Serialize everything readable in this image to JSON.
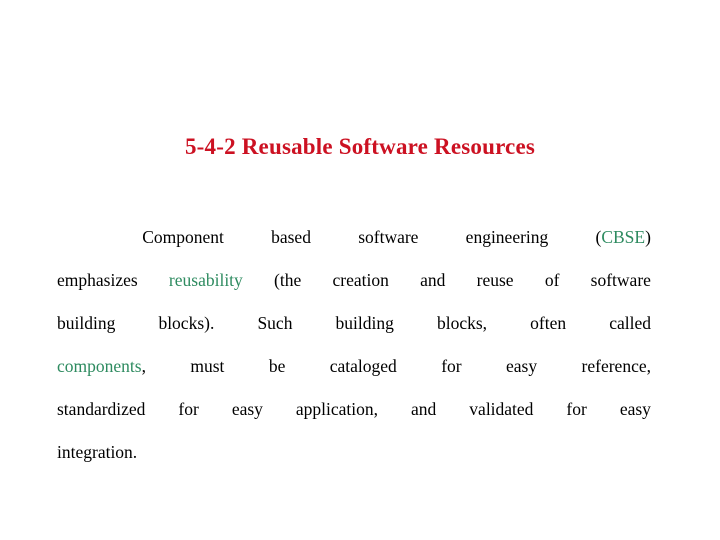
{
  "slide": {
    "background_color": "#ffffff",
    "title": "5-4-2 Reusable Software Resources",
    "title_color": "#cc1122",
    "body_color": "#000000",
    "highlight_color": "#2e8b60"
  },
  "body": {
    "full_text": "Component based software engineering (CBSE) emphasizes reusability (the creation and reuse of software building blocks). Such building blocks, often called components, must be cataloged for easy reference, standardized for easy application, and validated for easy integration.",
    "highlighted_terms": [
      "CBSE",
      "reusability",
      "components"
    ],
    "lines": [
      {
        "id": "line1",
        "align": "justify",
        "indent": true,
        "words": [
          {
            "text": "Component",
            "highlight": false
          },
          {
            "text": "based",
            "highlight": false
          },
          {
            "text": "software",
            "highlight": false
          },
          {
            "text": "engineering",
            "highlight": false
          },
          {
            "text": "(CBSE)",
            "highlight": false
          }
        ]
      },
      {
        "id": "line2",
        "align": "justify",
        "indent": false,
        "words": [
          {
            "text": "emphasizes",
            "highlight": false
          },
          {
            "text": "reusability",
            "highlight": true
          },
          {
            "text": "(the",
            "highlight": false
          },
          {
            "text": "creation",
            "highlight": false
          },
          {
            "text": "and",
            "highlight": false
          },
          {
            "text": "reuse",
            "highlight": false
          },
          {
            "text": "of",
            "highlight": false
          },
          {
            "text": "software",
            "highlight": false
          }
        ]
      },
      {
        "id": "line3",
        "align": "justify",
        "indent": false,
        "words": [
          {
            "text": "building",
            "highlight": false
          },
          {
            "text": "blocks).",
            "highlight": false
          },
          {
            "text": "Such",
            "highlight": false
          },
          {
            "text": "building",
            "highlight": false
          },
          {
            "text": "blocks,",
            "highlight": false
          },
          {
            "text": "often",
            "highlight": false
          },
          {
            "text": "called",
            "highlight": false
          }
        ]
      },
      {
        "id": "line4",
        "align": "justify",
        "indent": false,
        "words": [
          {
            "text": "components,",
            "highlight": false
          },
          {
            "text": "must",
            "highlight": false
          },
          {
            "text": "be",
            "highlight": false
          },
          {
            "text": "cataloged",
            "highlight": false
          },
          {
            "text": "for",
            "highlight": false
          },
          {
            "text": "easy",
            "highlight": false
          },
          {
            "text": "reference,",
            "highlight": false
          }
        ]
      },
      {
        "id": "line5",
        "align": "justify",
        "indent": false,
        "words": [
          {
            "text": "standardized",
            "highlight": false
          },
          {
            "text": "for",
            "highlight": false
          },
          {
            "text": "easy",
            "highlight": false
          },
          {
            "text": "application,",
            "highlight": false
          },
          {
            "text": "and",
            "highlight": false
          },
          {
            "text": "validated",
            "highlight": false
          },
          {
            "text": "for",
            "highlight": false
          },
          {
            "text": "easy",
            "highlight": false
          }
        ]
      },
      {
        "id": "line6",
        "align": "flush",
        "indent": false,
        "words": [
          {
            "text": "integration.",
            "highlight": false
          }
        ]
      }
    ]
  }
}
